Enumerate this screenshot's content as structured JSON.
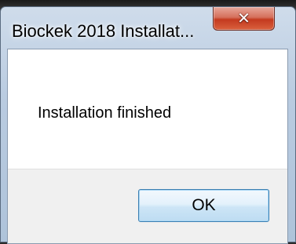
{
  "window": {
    "title": "Biockek 2018 Installat...",
    "close_icon": "close-icon"
  },
  "message": {
    "text": "Installation finished"
  },
  "buttons": {
    "ok_label": "OK"
  },
  "colors": {
    "close_button": "#c43a1f",
    "ok_border": "#3c7fb1",
    "button_area_bg": "#f0f0f0"
  }
}
